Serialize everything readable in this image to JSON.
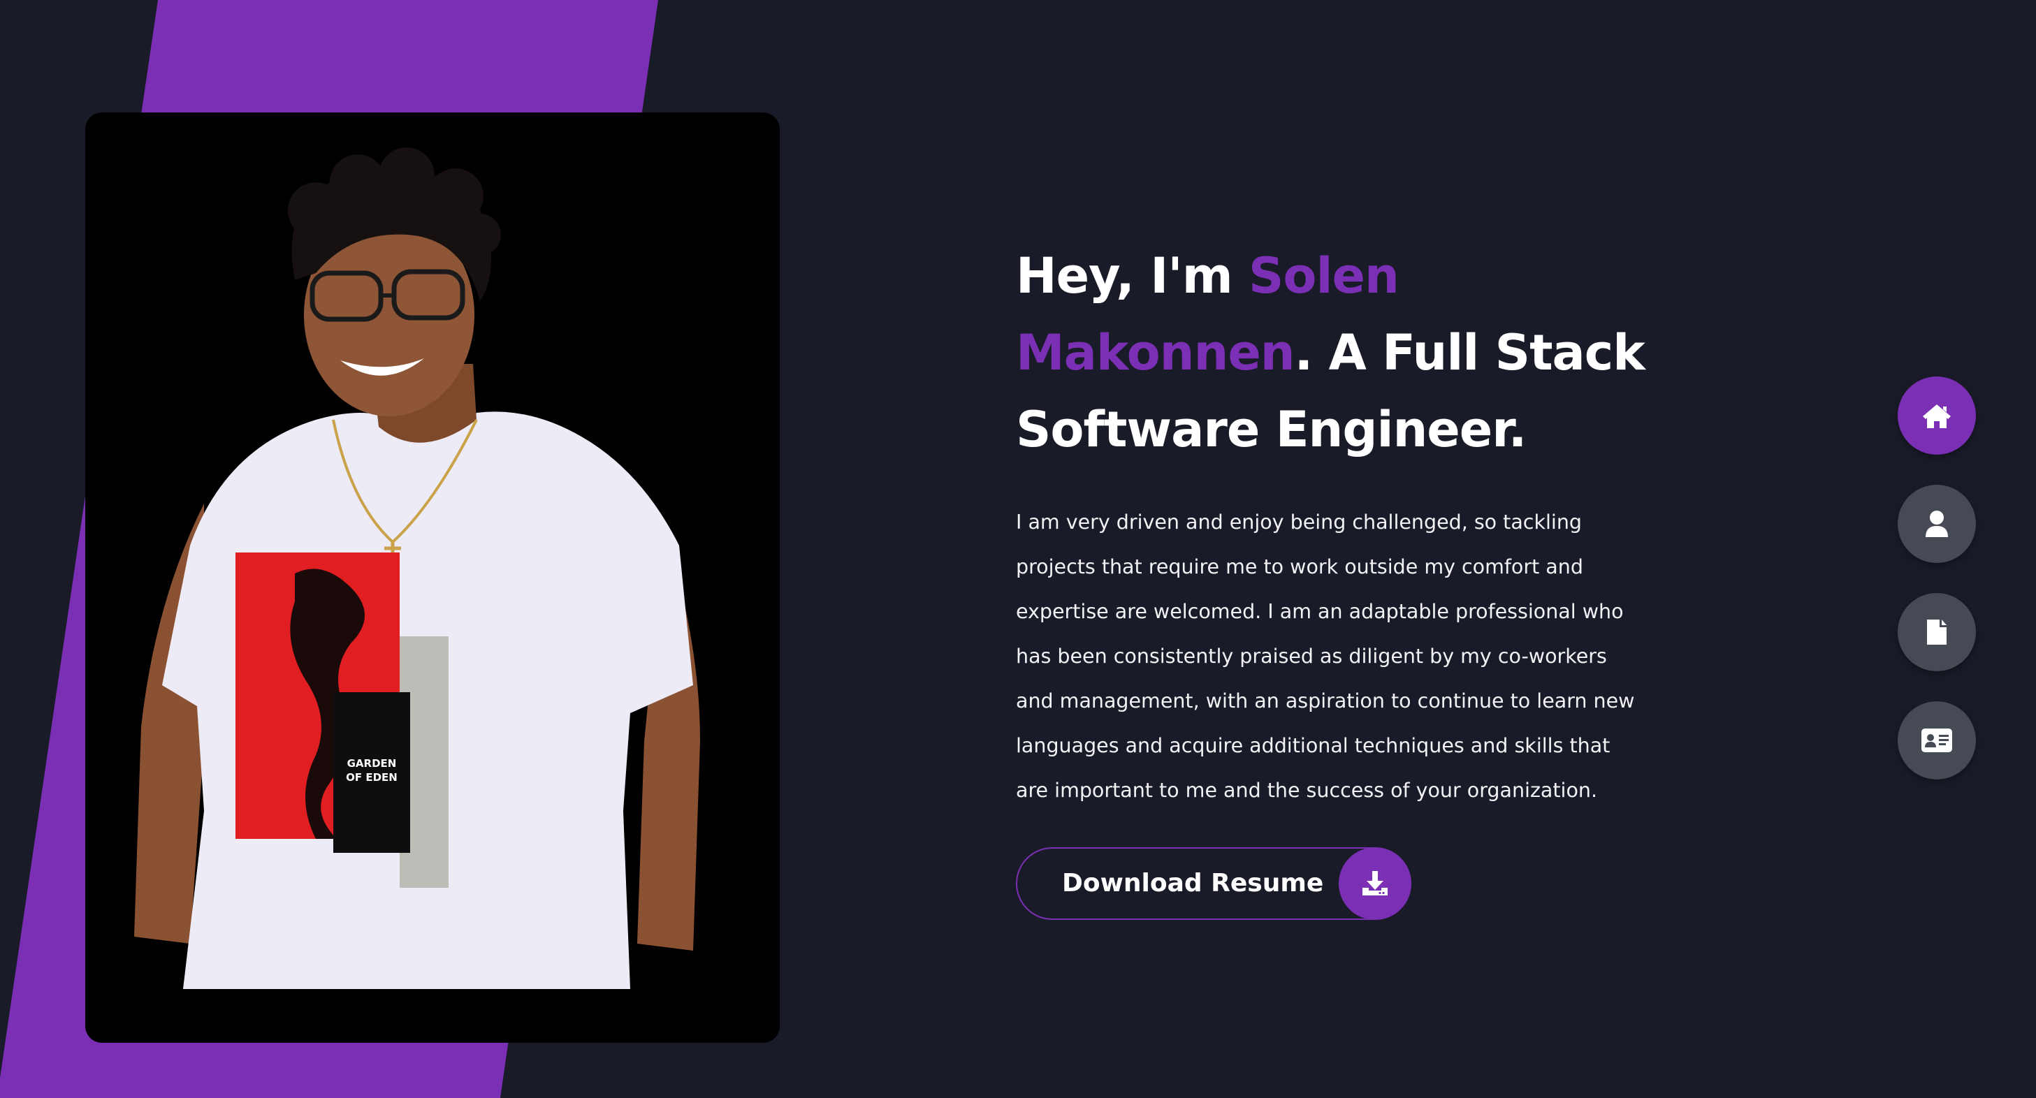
{
  "theme": {
    "background": "#191b28",
    "accent": "#7b2fb4",
    "nav_inactive": "#454a55",
    "text": "#ffffff"
  },
  "hero": {
    "greeting": "Hey, I'm ",
    "name": "Solen Makonnen",
    "title_rest": ". A Full Stack Software Engineer.",
    "description": "I am very driven and enjoy being challenged, so tackling projects that require me to work outside my comfort and expertise are welcomed. I am an adaptable professional who has been consistently praised as diligent by my co-workers and management, with an aspiration to continue to learn new languages and acquire additional techniques and skills that are important to me and the success of your organization."
  },
  "photo": {
    "shirt_text_line1": "GARDEN",
    "shirt_text_line2": "OF EDEN"
  },
  "download": {
    "label": "Download Resume",
    "icon": "download-icon"
  },
  "side_nav": [
    {
      "icon": "home-icon",
      "active": true
    },
    {
      "icon": "user-icon",
      "active": false
    },
    {
      "icon": "document-icon",
      "active": false
    },
    {
      "icon": "contact-card-icon",
      "active": false
    }
  ]
}
